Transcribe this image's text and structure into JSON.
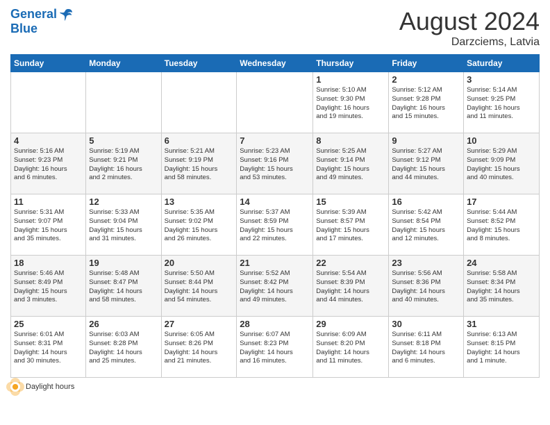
{
  "header": {
    "logo_line1": "General",
    "logo_line2": "Blue",
    "month_title": "August 2024",
    "subtitle": "Darzciems, Latvia"
  },
  "footer": {
    "daylight_label": "Daylight hours"
  },
  "calendar": {
    "days_of_week": [
      "Sunday",
      "Monday",
      "Tuesday",
      "Wednesday",
      "Thursday",
      "Friday",
      "Saturday"
    ],
    "rows": [
      [
        {
          "day": "",
          "info": ""
        },
        {
          "day": "",
          "info": ""
        },
        {
          "day": "",
          "info": ""
        },
        {
          "day": "",
          "info": ""
        },
        {
          "day": "1",
          "info": "Sunrise: 5:10 AM\nSunset: 9:30 PM\nDaylight: 16 hours\nand 19 minutes."
        },
        {
          "day": "2",
          "info": "Sunrise: 5:12 AM\nSunset: 9:28 PM\nDaylight: 16 hours\nand 15 minutes."
        },
        {
          "day": "3",
          "info": "Sunrise: 5:14 AM\nSunset: 9:25 PM\nDaylight: 16 hours\nand 11 minutes."
        }
      ],
      [
        {
          "day": "4",
          "info": "Sunrise: 5:16 AM\nSunset: 9:23 PM\nDaylight: 16 hours\nand 6 minutes."
        },
        {
          "day": "5",
          "info": "Sunrise: 5:19 AM\nSunset: 9:21 PM\nDaylight: 16 hours\nand 2 minutes."
        },
        {
          "day": "6",
          "info": "Sunrise: 5:21 AM\nSunset: 9:19 PM\nDaylight: 15 hours\nand 58 minutes."
        },
        {
          "day": "7",
          "info": "Sunrise: 5:23 AM\nSunset: 9:16 PM\nDaylight: 15 hours\nand 53 minutes."
        },
        {
          "day": "8",
          "info": "Sunrise: 5:25 AM\nSunset: 9:14 PM\nDaylight: 15 hours\nand 49 minutes."
        },
        {
          "day": "9",
          "info": "Sunrise: 5:27 AM\nSunset: 9:12 PM\nDaylight: 15 hours\nand 44 minutes."
        },
        {
          "day": "10",
          "info": "Sunrise: 5:29 AM\nSunset: 9:09 PM\nDaylight: 15 hours\nand 40 minutes."
        }
      ],
      [
        {
          "day": "11",
          "info": "Sunrise: 5:31 AM\nSunset: 9:07 PM\nDaylight: 15 hours\nand 35 minutes."
        },
        {
          "day": "12",
          "info": "Sunrise: 5:33 AM\nSunset: 9:04 PM\nDaylight: 15 hours\nand 31 minutes."
        },
        {
          "day": "13",
          "info": "Sunrise: 5:35 AM\nSunset: 9:02 PM\nDaylight: 15 hours\nand 26 minutes."
        },
        {
          "day": "14",
          "info": "Sunrise: 5:37 AM\nSunset: 8:59 PM\nDaylight: 15 hours\nand 22 minutes."
        },
        {
          "day": "15",
          "info": "Sunrise: 5:39 AM\nSunset: 8:57 PM\nDaylight: 15 hours\nand 17 minutes."
        },
        {
          "day": "16",
          "info": "Sunrise: 5:42 AM\nSunset: 8:54 PM\nDaylight: 15 hours\nand 12 minutes."
        },
        {
          "day": "17",
          "info": "Sunrise: 5:44 AM\nSunset: 8:52 PM\nDaylight: 15 hours\nand 8 minutes."
        }
      ],
      [
        {
          "day": "18",
          "info": "Sunrise: 5:46 AM\nSunset: 8:49 PM\nDaylight: 15 hours\nand 3 minutes."
        },
        {
          "day": "19",
          "info": "Sunrise: 5:48 AM\nSunset: 8:47 PM\nDaylight: 14 hours\nand 58 minutes."
        },
        {
          "day": "20",
          "info": "Sunrise: 5:50 AM\nSunset: 8:44 PM\nDaylight: 14 hours\nand 54 minutes."
        },
        {
          "day": "21",
          "info": "Sunrise: 5:52 AM\nSunset: 8:42 PM\nDaylight: 14 hours\nand 49 minutes."
        },
        {
          "day": "22",
          "info": "Sunrise: 5:54 AM\nSunset: 8:39 PM\nDaylight: 14 hours\nand 44 minutes."
        },
        {
          "day": "23",
          "info": "Sunrise: 5:56 AM\nSunset: 8:36 PM\nDaylight: 14 hours\nand 40 minutes."
        },
        {
          "day": "24",
          "info": "Sunrise: 5:58 AM\nSunset: 8:34 PM\nDaylight: 14 hours\nand 35 minutes."
        }
      ],
      [
        {
          "day": "25",
          "info": "Sunrise: 6:01 AM\nSunset: 8:31 PM\nDaylight: 14 hours\nand 30 minutes."
        },
        {
          "day": "26",
          "info": "Sunrise: 6:03 AM\nSunset: 8:28 PM\nDaylight: 14 hours\nand 25 minutes."
        },
        {
          "day": "27",
          "info": "Sunrise: 6:05 AM\nSunset: 8:26 PM\nDaylight: 14 hours\nand 21 minutes."
        },
        {
          "day": "28",
          "info": "Sunrise: 6:07 AM\nSunset: 8:23 PM\nDaylight: 14 hours\nand 16 minutes."
        },
        {
          "day": "29",
          "info": "Sunrise: 6:09 AM\nSunset: 8:20 PM\nDaylight: 14 hours\nand 11 minutes."
        },
        {
          "day": "30",
          "info": "Sunrise: 6:11 AM\nSunset: 8:18 PM\nDaylight: 14 hours\nand 6 minutes."
        },
        {
          "day": "31",
          "info": "Sunrise: 6:13 AM\nSunset: 8:15 PM\nDaylight: 14 hours\nand 1 minute."
        }
      ]
    ]
  }
}
